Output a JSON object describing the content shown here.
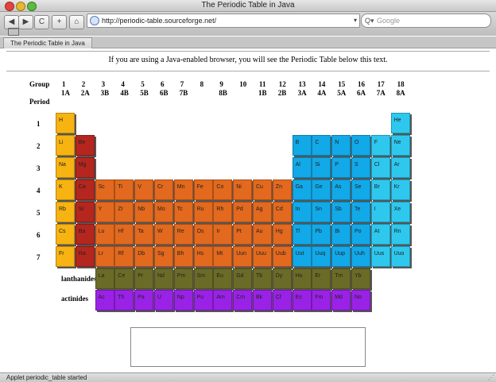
{
  "window": {
    "title": "The Periodic Table in Java"
  },
  "toolbar": {
    "back": "◀",
    "forward": "▶",
    "reload": "C",
    "add": "+",
    "home": "⌂",
    "url": "http://periodic-table.sourceforge.net/",
    "url_dropdown": "▾",
    "search_icon": "Q▾",
    "search_placeholder": "Google"
  },
  "bookmarks_icon": "book-icon",
  "tab": {
    "label": "The Periodic Table in Java"
  },
  "page": {
    "intro": "If you are using a Java-enabled browser, you will see the Periodic Table below this text.",
    "group_label": "Group",
    "period_label": "Period",
    "groups": [
      {
        "n": "1",
        "s": "1A"
      },
      {
        "n": "2",
        "s": "2A"
      },
      {
        "n": "3",
        "s": "3B"
      },
      {
        "n": "4",
        "s": "4B"
      },
      {
        "n": "5",
        "s": "5B"
      },
      {
        "n": "6",
        "s": "6B"
      },
      {
        "n": "7",
        "s": "7B"
      },
      {
        "n": "8",
        "s": ""
      },
      {
        "n": "9",
        "s": "8B"
      },
      {
        "n": "10",
        "s": ""
      },
      {
        "n": "11",
        "s": "1B"
      },
      {
        "n": "12",
        "s": "2B"
      },
      {
        "n": "13",
        "s": "3A"
      },
      {
        "n": "14",
        "s": "4A"
      },
      {
        "n": "15",
        "s": "5A"
      },
      {
        "n": "16",
        "s": "6A"
      },
      {
        "n": "17",
        "s": "7A"
      },
      {
        "n": "18",
        "s": "8A"
      }
    ],
    "periods": [
      "1",
      "2",
      "3",
      "4",
      "5",
      "6",
      "7"
    ],
    "lanthanides_label": "lanthanides",
    "actinides_label": "actinides"
  },
  "colors": {
    "alkali": "#f6b312",
    "alkaline": "#b5261e",
    "transition": "#e2691e",
    "nonmetal": "#12a9e8",
    "noble": "#2ec8ee",
    "lanthanide": "#6b6b28",
    "actinide": "#9a22e6"
  },
  "elements": [
    {
      "s": "H",
      "p": 1,
      "g": 1,
      "c": "alkali"
    },
    {
      "s": "He",
      "p": 1,
      "g": 18,
      "c": "noble"
    },
    {
      "s": "Li",
      "p": 2,
      "g": 1,
      "c": "alkali"
    },
    {
      "s": "Be",
      "p": 2,
      "g": 2,
      "c": "alkaline"
    },
    {
      "s": "B",
      "p": 2,
      "g": 13,
      "c": "nonmetal"
    },
    {
      "s": "C",
      "p": 2,
      "g": 14,
      "c": "nonmetal"
    },
    {
      "s": "N",
      "p": 2,
      "g": 15,
      "c": "nonmetal"
    },
    {
      "s": "O",
      "p": 2,
      "g": 16,
      "c": "nonmetal"
    },
    {
      "s": "F",
      "p": 2,
      "g": 17,
      "c": "noble"
    },
    {
      "s": "Ne",
      "p": 2,
      "g": 18,
      "c": "noble"
    },
    {
      "s": "Na",
      "p": 3,
      "g": 1,
      "c": "alkali"
    },
    {
      "s": "Mg",
      "p": 3,
      "g": 2,
      "c": "alkaline"
    },
    {
      "s": "Al",
      "p": 3,
      "g": 13,
      "c": "nonmetal"
    },
    {
      "s": "Si",
      "p": 3,
      "g": 14,
      "c": "nonmetal"
    },
    {
      "s": "P",
      "p": 3,
      "g": 15,
      "c": "nonmetal"
    },
    {
      "s": "S",
      "p": 3,
      "g": 16,
      "c": "nonmetal"
    },
    {
      "s": "Cl",
      "p": 3,
      "g": 17,
      "c": "noble"
    },
    {
      "s": "Ar",
      "p": 3,
      "g": 18,
      "c": "noble"
    },
    {
      "s": "K",
      "p": 4,
      "g": 1,
      "c": "alkali"
    },
    {
      "s": "Ca",
      "p": 4,
      "g": 2,
      "c": "alkaline"
    },
    {
      "s": "Sc",
      "p": 4,
      "g": 3,
      "c": "transition"
    },
    {
      "s": "Ti",
      "p": 4,
      "g": 4,
      "c": "transition"
    },
    {
      "s": "V",
      "p": 4,
      "g": 5,
      "c": "transition"
    },
    {
      "s": "Cr",
      "p": 4,
      "g": 6,
      "c": "transition"
    },
    {
      "s": "Mn",
      "p": 4,
      "g": 7,
      "c": "transition"
    },
    {
      "s": "Fe",
      "p": 4,
      "g": 8,
      "c": "transition"
    },
    {
      "s": "Co",
      "p": 4,
      "g": 9,
      "c": "transition"
    },
    {
      "s": "Ni",
      "p": 4,
      "g": 10,
      "c": "transition"
    },
    {
      "s": "Cu",
      "p": 4,
      "g": 11,
      "c": "transition"
    },
    {
      "s": "Zn",
      "p": 4,
      "g": 12,
      "c": "transition"
    },
    {
      "s": "Ga",
      "p": 4,
      "g": 13,
      "c": "nonmetal"
    },
    {
      "s": "Ge",
      "p": 4,
      "g": 14,
      "c": "nonmetal"
    },
    {
      "s": "As",
      "p": 4,
      "g": 15,
      "c": "nonmetal"
    },
    {
      "s": "Se",
      "p": 4,
      "g": 16,
      "c": "nonmetal"
    },
    {
      "s": "Br",
      "p": 4,
      "g": 17,
      "c": "noble"
    },
    {
      "s": "Kr",
      "p": 4,
      "g": 18,
      "c": "noble"
    },
    {
      "s": "Rb",
      "p": 5,
      "g": 1,
      "c": "alkali"
    },
    {
      "s": "Sr",
      "p": 5,
      "g": 2,
      "c": "alkaline"
    },
    {
      "s": "Y",
      "p": 5,
      "g": 3,
      "c": "transition"
    },
    {
      "s": "Zr",
      "p": 5,
      "g": 4,
      "c": "transition"
    },
    {
      "s": "Nb",
      "p": 5,
      "g": 5,
      "c": "transition"
    },
    {
      "s": "Mo",
      "p": 5,
      "g": 6,
      "c": "transition"
    },
    {
      "s": "Tc",
      "p": 5,
      "g": 7,
      "c": "transition"
    },
    {
      "s": "Ru",
      "p": 5,
      "g": 8,
      "c": "transition"
    },
    {
      "s": "Rh",
      "p": 5,
      "g": 9,
      "c": "transition"
    },
    {
      "s": "Pd",
      "p": 5,
      "g": 10,
      "c": "transition"
    },
    {
      "s": "Ag",
      "p": 5,
      "g": 11,
      "c": "transition"
    },
    {
      "s": "Cd",
      "p": 5,
      "g": 12,
      "c": "transition"
    },
    {
      "s": "In",
      "p": 5,
      "g": 13,
      "c": "nonmetal"
    },
    {
      "s": "Sn",
      "p": 5,
      "g": 14,
      "c": "nonmetal"
    },
    {
      "s": "Sb",
      "p": 5,
      "g": 15,
      "c": "nonmetal"
    },
    {
      "s": "Te",
      "p": 5,
      "g": 16,
      "c": "nonmetal"
    },
    {
      "s": "I",
      "p": 5,
      "g": 17,
      "c": "noble"
    },
    {
      "s": "Xe",
      "p": 5,
      "g": 18,
      "c": "noble"
    },
    {
      "s": "Cs",
      "p": 6,
      "g": 1,
      "c": "alkali"
    },
    {
      "s": "Ba",
      "p": 6,
      "g": 2,
      "c": "alkaline"
    },
    {
      "s": "Lu",
      "p": 6,
      "g": 3,
      "c": "transition"
    },
    {
      "s": "Hf",
      "p": 6,
      "g": 4,
      "c": "transition"
    },
    {
      "s": "Ta",
      "p": 6,
      "g": 5,
      "c": "transition"
    },
    {
      "s": "W",
      "p": 6,
      "g": 6,
      "c": "transition"
    },
    {
      "s": "Re",
      "p": 6,
      "g": 7,
      "c": "transition"
    },
    {
      "s": "Os",
      "p": 6,
      "g": 8,
      "c": "transition"
    },
    {
      "s": "Ir",
      "p": 6,
      "g": 9,
      "c": "transition"
    },
    {
      "s": "Pt",
      "p": 6,
      "g": 10,
      "c": "transition"
    },
    {
      "s": "Au",
      "p": 6,
      "g": 11,
      "c": "transition"
    },
    {
      "s": "Hg",
      "p": 6,
      "g": 12,
      "c": "transition"
    },
    {
      "s": "Tl",
      "p": 6,
      "g": 13,
      "c": "nonmetal"
    },
    {
      "s": "Pb",
      "p": 6,
      "g": 14,
      "c": "nonmetal"
    },
    {
      "s": "Bi",
      "p": 6,
      "g": 15,
      "c": "nonmetal"
    },
    {
      "s": "Po",
      "p": 6,
      "g": 16,
      "c": "nonmetal"
    },
    {
      "s": "At",
      "p": 6,
      "g": 17,
      "c": "noble"
    },
    {
      "s": "Rn",
      "p": 6,
      "g": 18,
      "c": "noble"
    },
    {
      "s": "Fr",
      "p": 7,
      "g": 1,
      "c": "alkali"
    },
    {
      "s": "Ra",
      "p": 7,
      "g": 2,
      "c": "alkaline"
    },
    {
      "s": "Lr",
      "p": 7,
      "g": 3,
      "c": "transition"
    },
    {
      "s": "Rf",
      "p": 7,
      "g": 4,
      "c": "transition"
    },
    {
      "s": "Db",
      "p": 7,
      "g": 5,
      "c": "transition"
    },
    {
      "s": "Sg",
      "p": 7,
      "g": 6,
      "c": "transition"
    },
    {
      "s": "Bh",
      "p": 7,
      "g": 7,
      "c": "transition"
    },
    {
      "s": "Hs",
      "p": 7,
      "g": 8,
      "c": "transition"
    },
    {
      "s": "Mt",
      "p": 7,
      "g": 9,
      "c": "transition"
    },
    {
      "s": "Uun",
      "p": 7,
      "g": 10,
      "c": "transition"
    },
    {
      "s": "Uuu",
      "p": 7,
      "g": 11,
      "c": "transition"
    },
    {
      "s": "Uub",
      "p": 7,
      "g": 12,
      "c": "transition"
    },
    {
      "s": "Uut",
      "p": 7,
      "g": 13,
      "c": "nonmetal"
    },
    {
      "s": "Uuq",
      "p": 7,
      "g": 14,
      "c": "nonmetal"
    },
    {
      "s": "Uup",
      "p": 7,
      "g": 15,
      "c": "nonmetal"
    },
    {
      "s": "Uuh",
      "p": 7,
      "g": 16,
      "c": "nonmetal"
    },
    {
      "s": "Uus",
      "p": 7,
      "g": 17,
      "c": "noble"
    },
    {
      "s": "Uuo",
      "p": 7,
      "g": 18,
      "c": "noble"
    }
  ],
  "lanthanides": [
    "La",
    "Ce",
    "Pr",
    "Nd",
    "Pm",
    "Sm",
    "Eu",
    "Gd",
    "Tb",
    "Dy",
    "Ho",
    "Er",
    "Tm",
    "Yb"
  ],
  "actinides": [
    "Ac",
    "Th",
    "Pa",
    "U",
    "Np",
    "Pu",
    "Am",
    "Cm",
    "Bk",
    "Cf",
    "Es",
    "Fm",
    "Md",
    "No"
  ],
  "status": {
    "text": "Applet periodic_table started"
  }
}
